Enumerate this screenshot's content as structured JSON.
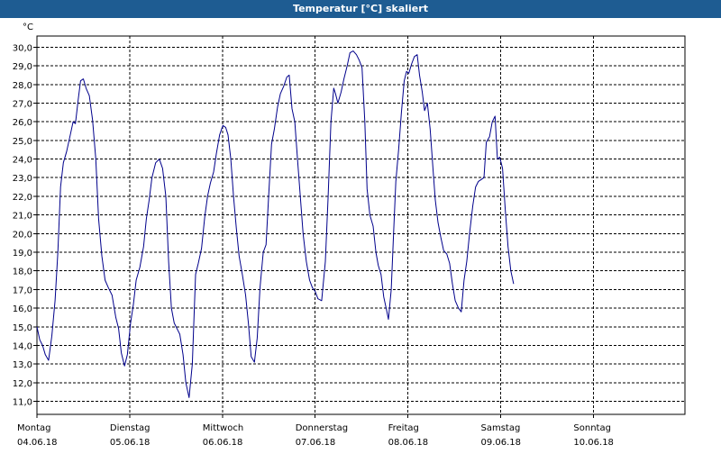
{
  "window": {
    "title": "Temperatur [°C] skaliert"
  },
  "colors": {
    "titlebar": "#1e5c92",
    "line": "#00008b",
    "grid": "#000000"
  },
  "chart_data": {
    "type": "line",
    "title": "Temperatur [°C] skaliert",
    "ylabel": "°C",
    "xlabel": "",
    "ylim": [
      10.3,
      30.6
    ],
    "xlim": [
      0,
      7
    ],
    "grid": true,
    "yticks": [
      {
        "value": 11.0,
        "label": "11,0"
      },
      {
        "value": 12.0,
        "label": "12,0"
      },
      {
        "value": 13.0,
        "label": "13,0"
      },
      {
        "value": 14.0,
        "label": "14,0"
      },
      {
        "value": 15.0,
        "label": "15,0"
      },
      {
        "value": 16.0,
        "label": "16,0"
      },
      {
        "value": 17.0,
        "label": "17,0"
      },
      {
        "value": 18.0,
        "label": "18,0"
      },
      {
        "value": 19.0,
        "label": "19,0"
      },
      {
        "value": 20.0,
        "label": "20,0"
      },
      {
        "value": 21.0,
        "label": "21,0"
      },
      {
        "value": 22.0,
        "label": "22,0"
      },
      {
        "value": 23.0,
        "label": "23,0"
      },
      {
        "value": 24.0,
        "label": "24,0"
      },
      {
        "value": 25.0,
        "label": "25,0"
      },
      {
        "value": 26.0,
        "label": "26,0"
      },
      {
        "value": 27.0,
        "label": "27,0"
      },
      {
        "value": 28.0,
        "label": "28,0"
      },
      {
        "value": 29.0,
        "label": "29,0"
      },
      {
        "value": 30.0,
        "label": "30,0"
      }
    ],
    "xticks": [
      {
        "day": "Montag",
        "date": "04.06.18"
      },
      {
        "day": "Dienstag",
        "date": "05.06.18"
      },
      {
        "day": "Mittwoch",
        "date": "06.06.18"
      },
      {
        "day": "Donnerstag",
        "date": "07.06.18"
      },
      {
        "day": "Freitag",
        "date": "08.06.18"
      },
      {
        "day": "Samstag",
        "date": "09.06.18"
      },
      {
        "day": "Sonntag",
        "date": "10.06.18"
      }
    ],
    "series": [
      {
        "values": [
          [
            0.0,
            15.0
          ],
          [
            0.03,
            14.3
          ],
          [
            0.06,
            14.0
          ],
          [
            0.09,
            13.5
          ],
          [
            0.125,
            13.2
          ],
          [
            0.16,
            14.5
          ],
          [
            0.195,
            16.4
          ],
          [
            0.225,
            19.0
          ],
          [
            0.255,
            22.5
          ],
          [
            0.285,
            23.8
          ],
          [
            0.32,
            24.4
          ],
          [
            0.36,
            25.3
          ],
          [
            0.39,
            26.0
          ],
          [
            0.415,
            25.9
          ],
          [
            0.445,
            27.2
          ],
          [
            0.47,
            28.2
          ],
          [
            0.5,
            28.3
          ],
          [
            0.53,
            27.8
          ],
          [
            0.565,
            27.4
          ],
          [
            0.6,
            26.1
          ],
          [
            0.635,
            24.0
          ],
          [
            0.665,
            20.8
          ],
          [
            0.7,
            18.8
          ],
          [
            0.735,
            17.5
          ],
          [
            0.77,
            17.1
          ],
          [
            0.81,
            16.7
          ],
          [
            0.85,
            15.5
          ],
          [
            0.88,
            14.9
          ],
          [
            0.91,
            13.6
          ],
          [
            0.945,
            12.9
          ],
          [
            0.975,
            13.5
          ],
          [
            1.01,
            15.2
          ],
          [
            1.04,
            16.2
          ],
          [
            1.07,
            17.5
          ],
          [
            1.11,
            18.2
          ],
          [
            1.15,
            19.3
          ],
          [
            1.18,
            20.8
          ],
          [
            1.21,
            21.8
          ],
          [
            1.24,
            23.0
          ],
          [
            1.28,
            23.8
          ],
          [
            1.32,
            24.0
          ],
          [
            1.355,
            23.5
          ],
          [
            1.39,
            22.0
          ],
          [
            1.42,
            18.5
          ],
          [
            1.45,
            16.0
          ],
          [
            1.48,
            15.2
          ],
          [
            1.51,
            14.9
          ],
          [
            1.54,
            14.6
          ],
          [
            1.575,
            13.5
          ],
          [
            1.605,
            12.0
          ],
          [
            1.64,
            11.2
          ],
          [
            1.675,
            13.0
          ],
          [
            1.71,
            17.8
          ],
          [
            1.74,
            18.4
          ],
          [
            1.775,
            19.2
          ],
          [
            1.81,
            20.9
          ],
          [
            1.84,
            22.0
          ],
          [
            1.87,
            22.7
          ],
          [
            1.905,
            23.3
          ],
          [
            1.935,
            24.3
          ],
          [
            1.97,
            25.3
          ],
          [
            2.005,
            25.8
          ],
          [
            2.035,
            25.7
          ],
          [
            2.06,
            25.3
          ],
          [
            2.09,
            24.0
          ],
          [
            2.12,
            22.0
          ],
          [
            2.15,
            20.3
          ],
          [
            2.18,
            18.8
          ],
          [
            2.215,
            17.8
          ],
          [
            2.25,
            16.7
          ],
          [
            2.28,
            15.2
          ],
          [
            2.31,
            13.4
          ],
          [
            2.345,
            13.1
          ],
          [
            2.375,
            14.4
          ],
          [
            2.405,
            17.1
          ],
          [
            2.44,
            19.0
          ],
          [
            2.47,
            19.4
          ],
          [
            2.5,
            22.2
          ],
          [
            2.53,
            24.8
          ],
          [
            2.56,
            25.6
          ],
          [
            2.595,
            26.8
          ],
          [
            2.625,
            27.5
          ],
          [
            2.66,
            27.9
          ],
          [
            2.695,
            28.4
          ],
          [
            2.72,
            28.5
          ],
          [
            2.75,
            26.7
          ],
          [
            2.78,
            26.0
          ],
          [
            2.81,
            24.0
          ],
          [
            2.84,
            22.0
          ],
          [
            2.87,
            20.0
          ],
          [
            2.905,
            18.5
          ],
          [
            2.94,
            17.5
          ],
          [
            2.97,
            17.1
          ],
          [
            3.0,
            16.9
          ],
          [
            3.03,
            16.5
          ],
          [
            3.07,
            16.4
          ],
          [
            3.11,
            18.5
          ],
          [
            3.14,
            22.0
          ],
          [
            3.17,
            26.0
          ],
          [
            3.2,
            27.8
          ],
          [
            3.22,
            27.5
          ],
          [
            3.245,
            27.0
          ],
          [
            3.28,
            27.6
          ],
          [
            3.31,
            28.3
          ],
          [
            3.345,
            29.0
          ],
          [
            3.375,
            29.7
          ],
          [
            3.41,
            29.8
          ],
          [
            3.445,
            29.6
          ],
          [
            3.475,
            29.3
          ],
          [
            3.505,
            28.9
          ],
          [
            3.535,
            26.0
          ],
          [
            3.56,
            22.4
          ],
          [
            3.59,
            21.0
          ],
          [
            3.625,
            20.4
          ],
          [
            3.655,
            19.0
          ],
          [
            3.68,
            18.3
          ],
          [
            3.71,
            17.8
          ],
          [
            3.74,
            16.6
          ],
          [
            3.77,
            15.9
          ],
          [
            3.79,
            15.4
          ],
          [
            3.82,
            17.0
          ],
          [
            3.845,
            20.0
          ],
          [
            3.87,
            22.8
          ],
          [
            3.9,
            24.5
          ],
          [
            3.93,
            26.5
          ],
          [
            3.96,
            28.2
          ],
          [
            3.985,
            28.7
          ],
          [
            4.01,
            28.6
          ],
          [
            4.04,
            29.1
          ],
          [
            4.07,
            29.5
          ],
          [
            4.1,
            29.6
          ],
          [
            4.125,
            28.5
          ],
          [
            4.155,
            27.6
          ],
          [
            4.18,
            26.6
          ],
          [
            4.21,
            27.0
          ],
          [
            4.24,
            25.6
          ],
          [
            4.27,
            23.5
          ],
          [
            4.295,
            21.8
          ],
          [
            4.325,
            20.6
          ],
          [
            4.355,
            19.8
          ],
          [
            4.385,
            19.1
          ],
          [
            4.42,
            18.9
          ],
          [
            4.45,
            18.4
          ],
          [
            4.48,
            17.3
          ],
          [
            4.51,
            16.4
          ],
          [
            4.545,
            16.0
          ],
          [
            4.575,
            15.8
          ],
          [
            4.605,
            17.5
          ],
          [
            4.635,
            18.5
          ],
          [
            4.665,
            20.0
          ],
          [
            4.7,
            21.5
          ],
          [
            4.73,
            22.5
          ],
          [
            4.76,
            22.8
          ],
          [
            4.79,
            22.9
          ],
          [
            4.82,
            23.0
          ],
          [
            4.845,
            24.9
          ],
          [
            4.88,
            25.2
          ],
          [
            4.91,
            26.0
          ],
          [
            4.94,
            26.3
          ],
          [
            4.965,
            24.0
          ],
          [
            4.99,
            24.1
          ],
          [
            5.02,
            23.5
          ],
          [
            5.05,
            21.3
          ],
          [
            5.08,
            19.3
          ],
          [
            5.11,
            18.0
          ],
          [
            5.14,
            17.3
          ]
        ]
      }
    ]
  }
}
